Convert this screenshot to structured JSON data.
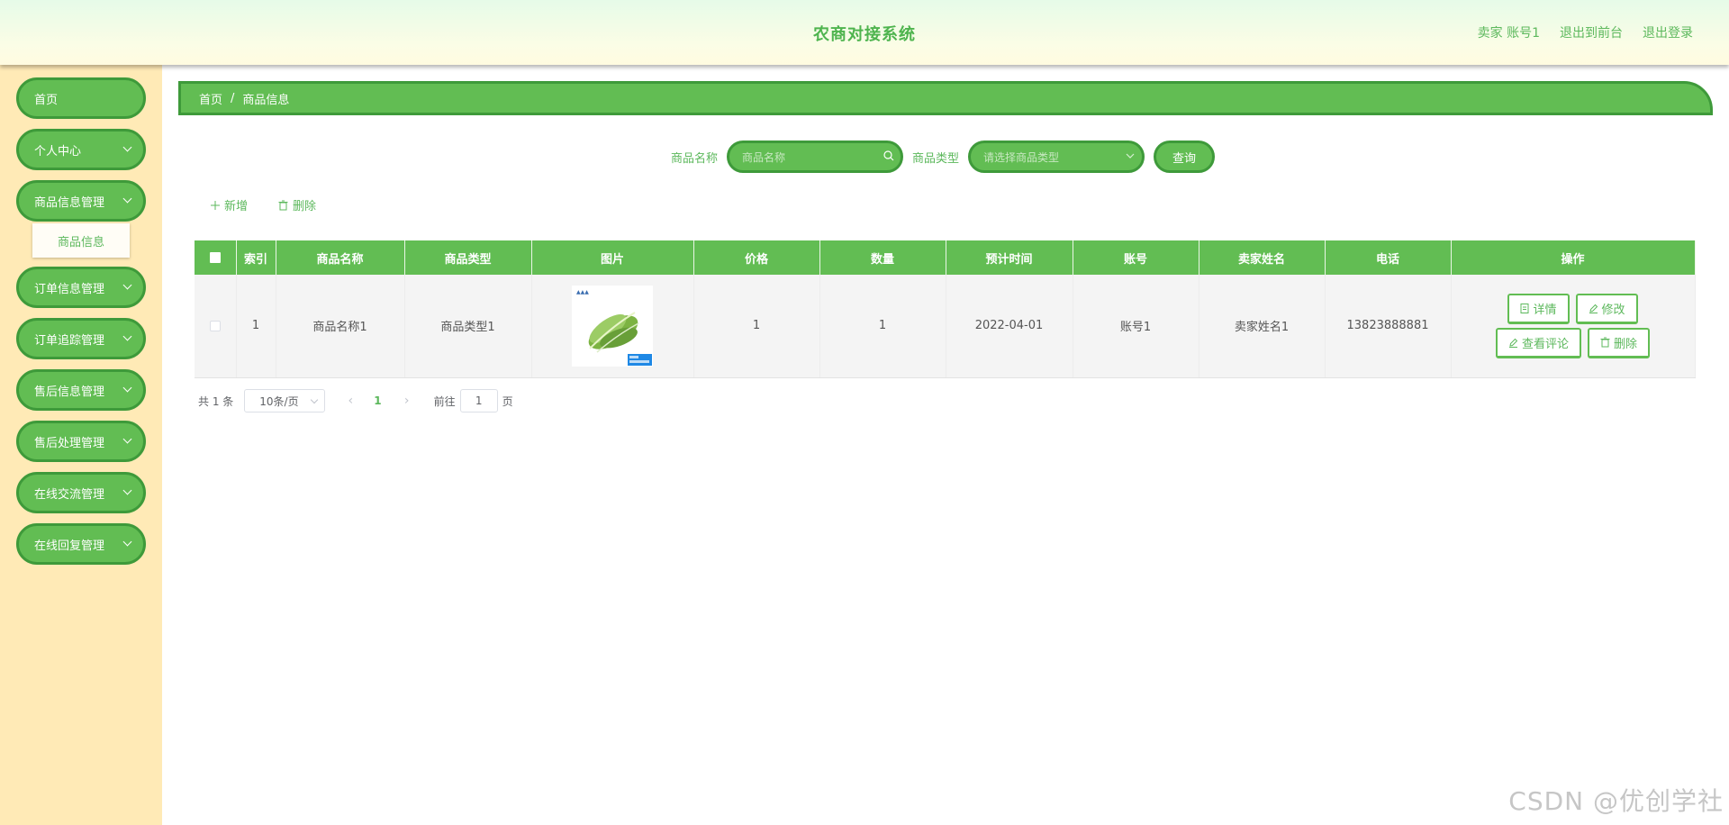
{
  "header": {
    "title": "农商对接系统",
    "user": "卖家 账号1",
    "to_front": "退出到前台",
    "logout": "退出登录"
  },
  "sidebar": {
    "items": [
      {
        "label": "首页",
        "has_arrow": false
      },
      {
        "label": "个人中心",
        "has_arrow": true
      },
      {
        "label": "商品信息管理",
        "has_arrow": true
      },
      {
        "label": "订单信息管理",
        "has_arrow": true
      },
      {
        "label": "订单追踪管理",
        "has_arrow": true
      },
      {
        "label": "售后信息管理",
        "has_arrow": true
      },
      {
        "label": "售后处理管理",
        "has_arrow": true
      },
      {
        "label": "在线交流管理",
        "has_arrow": true
      },
      {
        "label": "在线回复管理",
        "has_arrow": true
      }
    ],
    "submenu": {
      "label": "商品信息"
    }
  },
  "breadcrumb": {
    "home": "首页",
    "sep": "/",
    "current": "商品信息"
  },
  "search": {
    "name_label": "商品名称",
    "name_placeholder": "商品名称",
    "type_label": "商品类型",
    "type_placeholder": "请选择商品类型",
    "query": "查询"
  },
  "actions": {
    "add": "新增",
    "delete": "删除"
  },
  "table": {
    "columns": [
      "索引",
      "商品名称",
      "商品类型",
      "图片",
      "价格",
      "数量",
      "预计时间",
      "账号",
      "卖家姓名",
      "电话",
      "操作"
    ],
    "rows": [
      {
        "index": "1",
        "name": "商品名称1",
        "type": "商品类型1",
        "price": "1",
        "quantity": "1",
        "time": "2022-04-01",
        "account": "账号1",
        "seller": "卖家姓名1",
        "phone": "13823888881",
        "ops": {
          "detail": "详情",
          "edit": "修改",
          "comments": "查看评论",
          "delete": "删除"
        }
      }
    ]
  },
  "pagination": {
    "total": "共 1 条",
    "page_size": "10条/页",
    "current": "1",
    "goto_prefix": "前往",
    "goto_value": "1",
    "goto_suffix": "页"
  },
  "watermark": "CSDN @优创学社",
  "colors": {
    "accent": "#62bd53",
    "accent_border": "#3e9a3a",
    "sidebar_bg": "#ffeab6",
    "text_green": "#5cb85c"
  }
}
